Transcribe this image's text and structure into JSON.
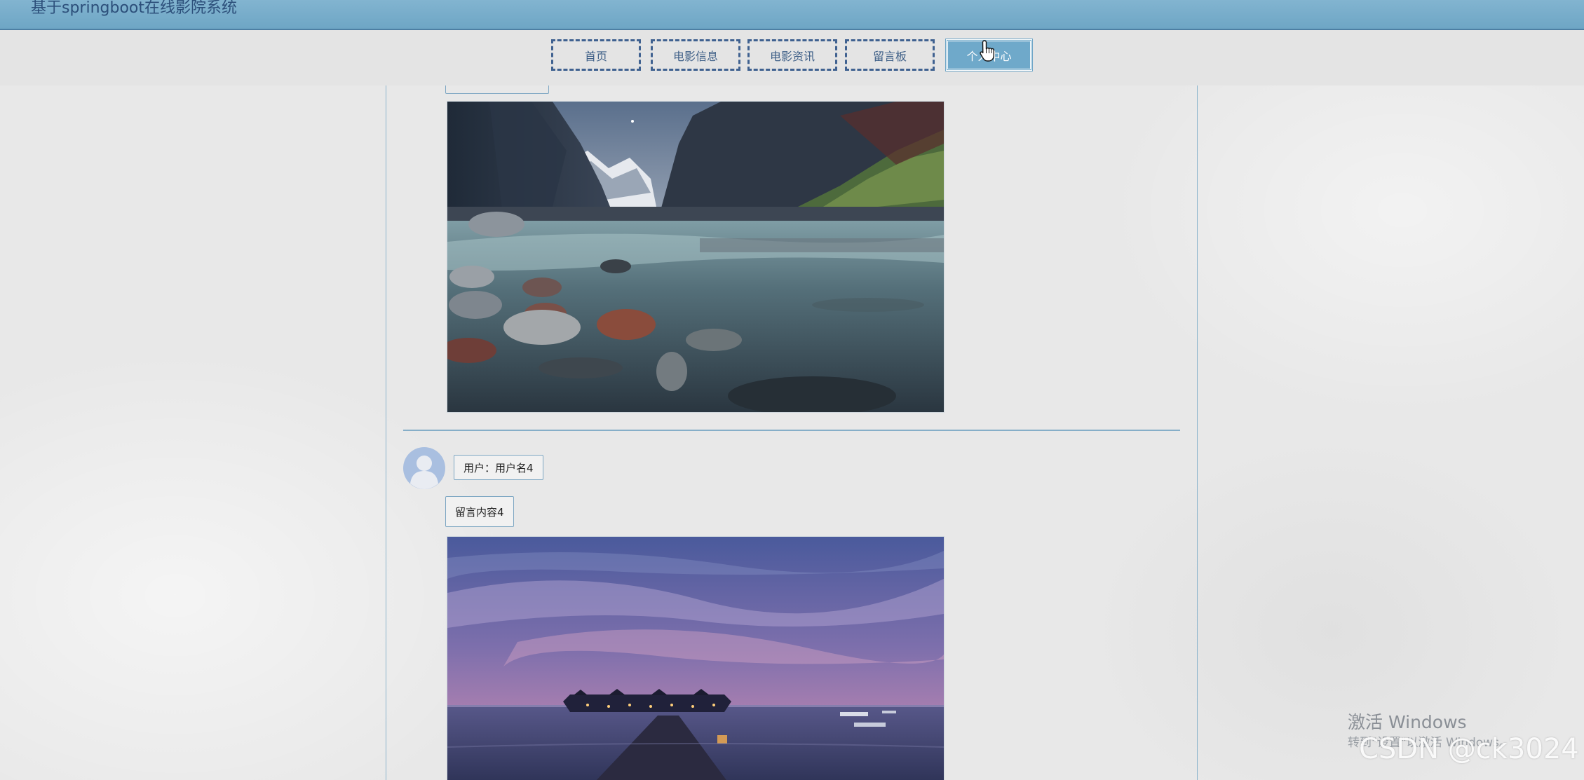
{
  "header": {
    "site_title": "基于springboot在线影院系统"
  },
  "nav": {
    "items": [
      {
        "label": "首页"
      },
      {
        "label": "电影信息"
      },
      {
        "label": "电影资讯"
      },
      {
        "label": "留言板"
      },
      {
        "label": "个人中心",
        "active": true
      }
    ]
  },
  "messages": [
    {
      "image_description": "mountain-valley-river-photo"
    },
    {
      "user_label": "用户：用户名4",
      "content": "留言内容4",
      "image_description": "overwater-bungalows-dusk-photo"
    }
  ],
  "overlay": {
    "activate_title": "激活 Windows",
    "activate_sub": "转到\"设置\"以激活 Windows。",
    "csdn_watermark": "CSDN @ck3024"
  },
  "colors": {
    "topbar": "#76abc9",
    "nav_border": "#3f6190",
    "nav_active_bg": "#6fa9ca",
    "content_border": "#8db5cd"
  }
}
